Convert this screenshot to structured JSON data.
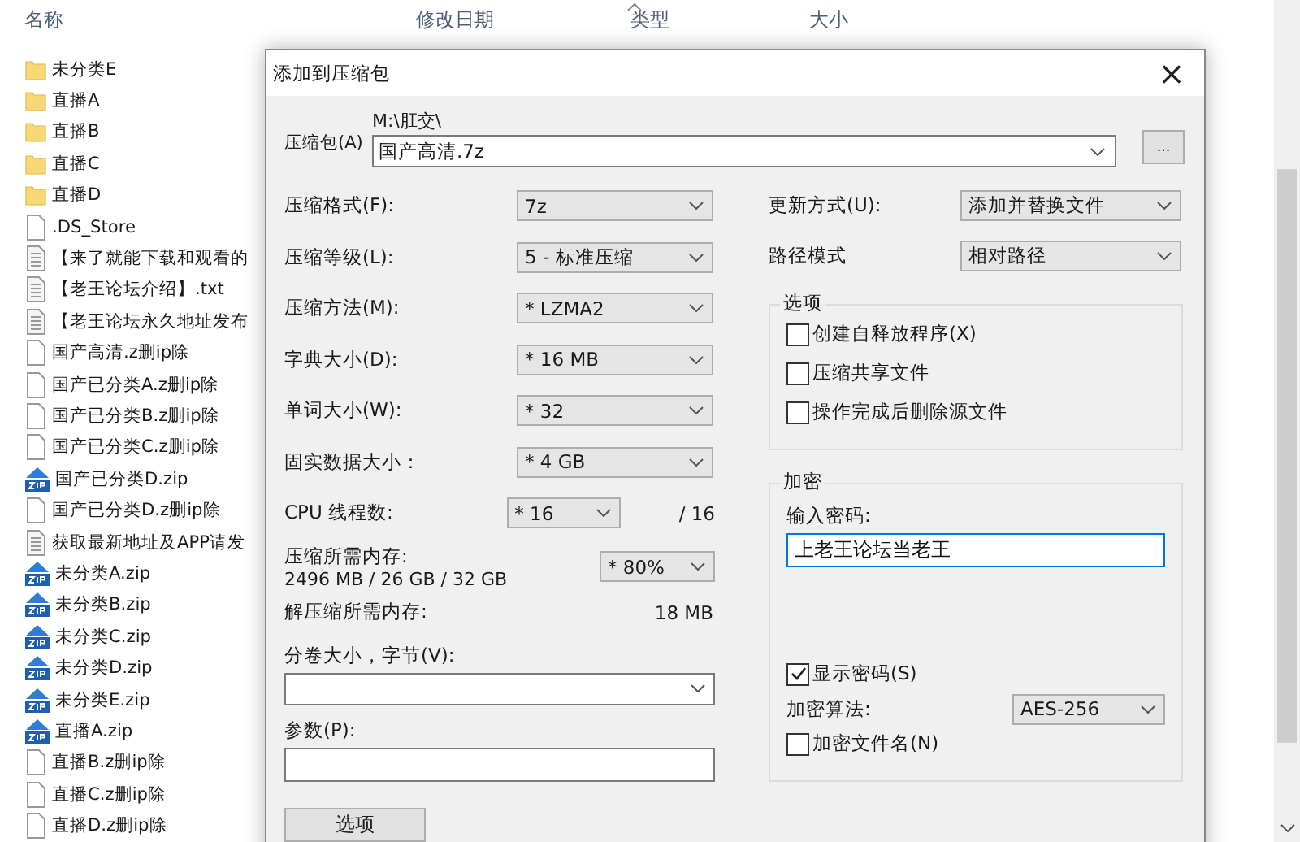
{
  "explorer": {
    "columns": [
      "名称",
      "修改日期",
      "类型",
      "大小"
    ],
    "files": [
      {
        "name": "未分类E",
        "kind": "folder"
      },
      {
        "name": "直播A",
        "kind": "folder"
      },
      {
        "name": "直播B",
        "kind": "folder"
      },
      {
        "name": "直播C",
        "kind": "folder"
      },
      {
        "name": "直播D",
        "kind": "folder"
      },
      {
        "name": ".DS_Store",
        "kind": "file"
      },
      {
        "name": "【来了就能下载和观看的",
        "kind": "text"
      },
      {
        "name": "【老王论坛介绍】.txt",
        "kind": "text"
      },
      {
        "name": "【老王论坛永久地址发布",
        "kind": "text"
      },
      {
        "name": "国产高清.z删ip除",
        "kind": "file"
      },
      {
        "name": "国产已分类A.z删ip除",
        "kind": "file"
      },
      {
        "name": "国产已分类B.z删ip除",
        "kind": "file"
      },
      {
        "name": "国产已分类C.z删ip除",
        "kind": "file"
      },
      {
        "name": "国产已分类D.zip",
        "kind": "zip"
      },
      {
        "name": "国产已分类D.z删ip除",
        "kind": "file"
      },
      {
        "name": "获取最新地址及APP请发",
        "kind": "text"
      },
      {
        "name": "未分类A.zip",
        "kind": "zip"
      },
      {
        "name": "未分类B.zip",
        "kind": "zip"
      },
      {
        "name": "未分类C.zip",
        "kind": "zip"
      },
      {
        "name": "未分类D.zip",
        "kind": "zip"
      },
      {
        "name": "未分类E.zip",
        "kind": "zip"
      },
      {
        "name": "直播A.zip",
        "kind": "zip"
      },
      {
        "name": "直播B.z删ip除",
        "kind": "file"
      },
      {
        "name": "直播C.z删ip除",
        "kind": "file"
      },
      {
        "name": "直播D.z删ip除",
        "kind": "file"
      }
    ]
  },
  "dialog": {
    "title": "添加到压缩包",
    "close": "×",
    "archive": {
      "label": "压缩包(A)",
      "path": "M:\\肛交\\",
      "value": "国产高清.7z"
    },
    "browse_button": "...",
    "settings": [
      {
        "label": "压缩格式(F):",
        "value": "7z"
      },
      {
        "label": "压缩等级(L):",
        "value": "5 - 标准压缩"
      },
      {
        "label": "压缩方法(M):",
        "value": "* LZMA2"
      },
      {
        "label": "字典大小(D):",
        "value": "* 16 MB"
      },
      {
        "label": "单词大小(W):",
        "value": "* 32"
      },
      {
        "label": "固实数据大小：",
        "value": "* 4 GB"
      }
    ],
    "cpu": {
      "label": "CPU 线程数:",
      "value": "* 16",
      "max": "/ 16"
    },
    "memory": {
      "label": "压缩所需内存:",
      "detail": "2496 MB / 26 GB / 32 GB",
      "value": "* 80%"
    },
    "decompress_memory": {
      "label": "解压缩所需内存:",
      "value": "18 MB"
    },
    "volume": {
      "label": "分卷大小，字节(V):"
    },
    "params": {
      "label": "参数(P):"
    },
    "options_button": "选项",
    "update": {
      "label": "更新方式(U):",
      "value": "添加并替换文件"
    },
    "path_mode": {
      "label": "路径模式",
      "value": "相对路径"
    },
    "options_group": {
      "title": "选项",
      "checkboxes": [
        {
          "label": "创建自释放程序(X)",
          "checked": false
        },
        {
          "label": "压缩共享文件",
          "checked": false
        },
        {
          "label": "操作完成后删除源文件",
          "checked": false
        }
      ]
    },
    "encryption": {
      "title": "加密",
      "password_label": "输入密码:",
      "password": "上老王论坛当老王",
      "show_password": {
        "label": "显示密码(S)",
        "checked": true
      },
      "method": {
        "label": "加密算法:",
        "value": "AES-256"
      },
      "encrypt_names": {
        "label": "加密文件名(N)",
        "checked": false
      }
    }
  }
}
